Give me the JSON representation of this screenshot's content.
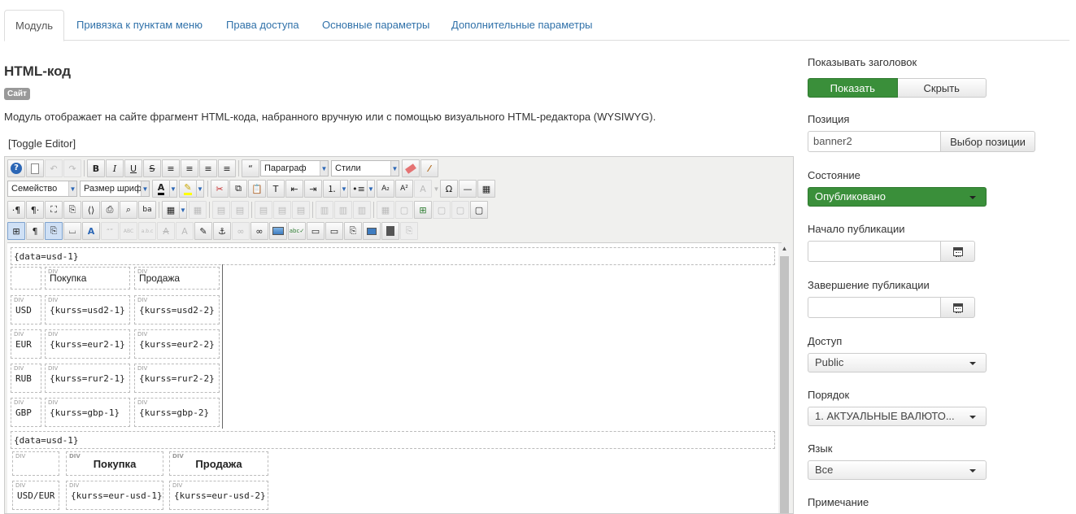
{
  "tabs": [
    "Модуль",
    "Привязка к пунктам меню",
    "Права доступа",
    "Основные параметры",
    "Дополнительные параметры"
  ],
  "module": {
    "title": "HTML-код",
    "badge": "Сайт",
    "description": "Модуль отображает на сайте фрагмент HTML-кода, набранного вручную или с помощью визуального HTML-редактора (WYSIWYG).",
    "toggle_editor": "[Toggle Editor]"
  },
  "editor": {
    "format_select": "Параграф",
    "styles_select": "Стили",
    "font_family_select": "Семейство",
    "font_size_select": "Размер шрифта",
    "glyphs": {
      "bold": "B",
      "italic": "I",
      "underline": "U",
      "strike": "S",
      "subscript": "A₂",
      "superscript": "A²",
      "omega": "Ω",
      "quote": "“",
      "pilcrow": "¶",
      "ltr": "·¶",
      "rtl": "¶·",
      "abc": "ABC",
      "abc2": "a.b.c",
      "quote2": "“”"
    },
    "content": {
      "data_tag_1": "{data=usd-1}",
      "table1_headers": [
        "Покупка",
        "Продажа"
      ],
      "table1_rows": [
        {
          "cur": "USD",
          "buy": "{kurss=usd2-1}",
          "sell": "{kurss=usd2-2}"
        },
        {
          "cur": "EUR",
          "buy": "{kurss=eur2-1}",
          "sell": "{kurss=eur2-2}"
        },
        {
          "cur": "RUB",
          "buy": "{kurss=rur2-1}",
          "sell": "{kurss=rur2-2}"
        },
        {
          "cur": "GBP",
          "buy": "{kurss=gbp-1}",
          "sell": "{kurss=gbp-2}"
        }
      ],
      "data_tag_2": "{data=usd-1}",
      "table2_headers": [
        "Покупка",
        "Продажа"
      ],
      "table2_rows": [
        {
          "cur": "USD/EUR",
          "buy": "{kurss=eur-usd-1}",
          "sell": "{kurss=eur-usd-2}"
        }
      ],
      "div_tag": "DIV"
    }
  },
  "sidebar": {
    "show_title_label": "Показывать заголовок",
    "show_btn": "Показать",
    "hide_btn": "Скрыть",
    "position_label": "Позиция",
    "position_value": "banner2",
    "position_btn": "Выбор позиции",
    "state_label": "Состояние",
    "state_value": "Опубликовано",
    "publish_start_label": "Начало публикации",
    "publish_end_label": "Завершение публикации",
    "access_label": "Доступ",
    "access_value": "Public",
    "order_label": "Порядок",
    "order_value": "1. АКТУАЛЬНЫЕ ВАЛЮТО...",
    "language_label": "Язык",
    "language_value": "Все",
    "note_label": "Примечание"
  },
  "colors": {
    "accent_green": "#3a8f3a",
    "link_blue": "#3071a9"
  }
}
